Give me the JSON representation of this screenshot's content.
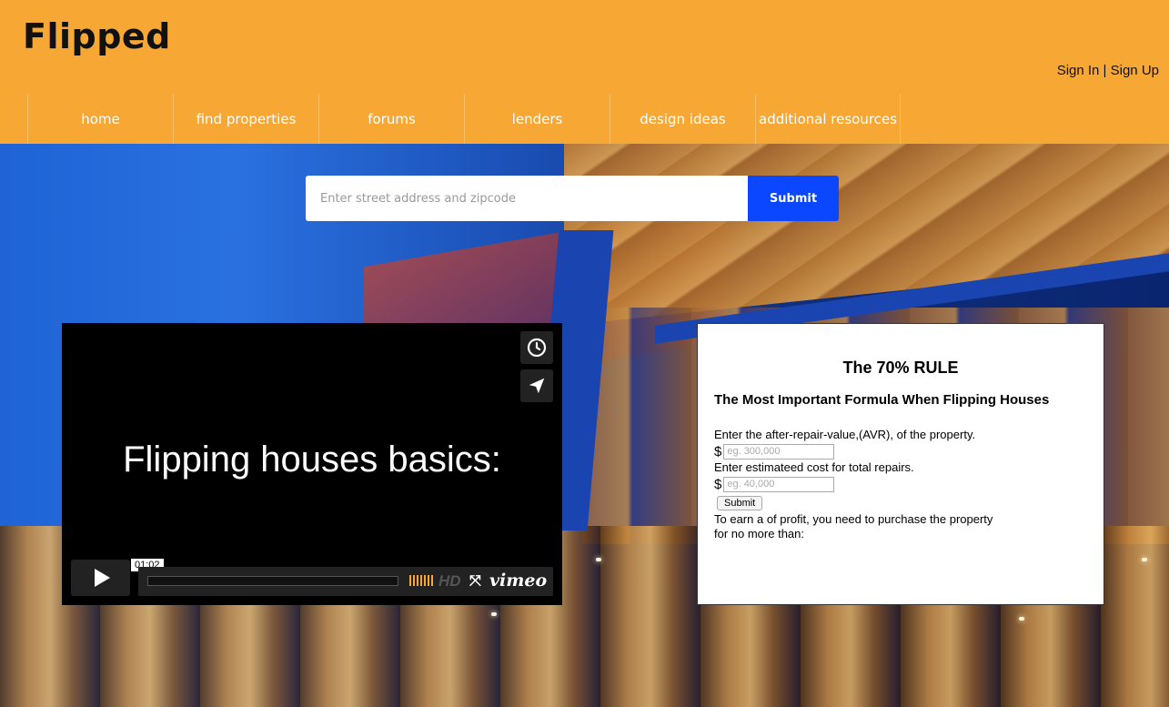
{
  "header": {
    "logo": "Flipped",
    "sign_in": "Sign In",
    "separator": " | ",
    "sign_up": "Sign Up"
  },
  "nav": {
    "items": [
      {
        "label": "home"
      },
      {
        "label": "find properties"
      },
      {
        "label": "forums"
      },
      {
        "label": "lenders"
      },
      {
        "label": "design ideas"
      },
      {
        "label": "additional resources"
      }
    ]
  },
  "search": {
    "placeholder": "Enter street address and zipcode",
    "value": "",
    "submit_label": "Submit"
  },
  "video": {
    "title": "Flipping houses basics:",
    "time": "01:02",
    "hd_label": "HD",
    "brand": "vimeo",
    "icons": [
      "clock-icon",
      "send-icon",
      "play-icon",
      "fullscreen-icon"
    ]
  },
  "calculator": {
    "title": "The 70% RULE",
    "subtitle": "The Most Important Formula When Flipping Houses",
    "arv_label": "Enter the after-repair-value,(AVR), of the property.",
    "currency": "$",
    "arv_placeholder": "eg. 300,000",
    "repairs_label": "Enter estimateed cost for total repairs.",
    "repairs_placeholder": "eg. 40,000",
    "submit_label": "Submit",
    "result_line1": "To earn a of profit, you need to purchase the property",
    "result_line2": "for no more than:"
  },
  "colors": {
    "header_bg": "#f7a733",
    "search_button": "#0a47ff",
    "video_bg": "#000000"
  }
}
